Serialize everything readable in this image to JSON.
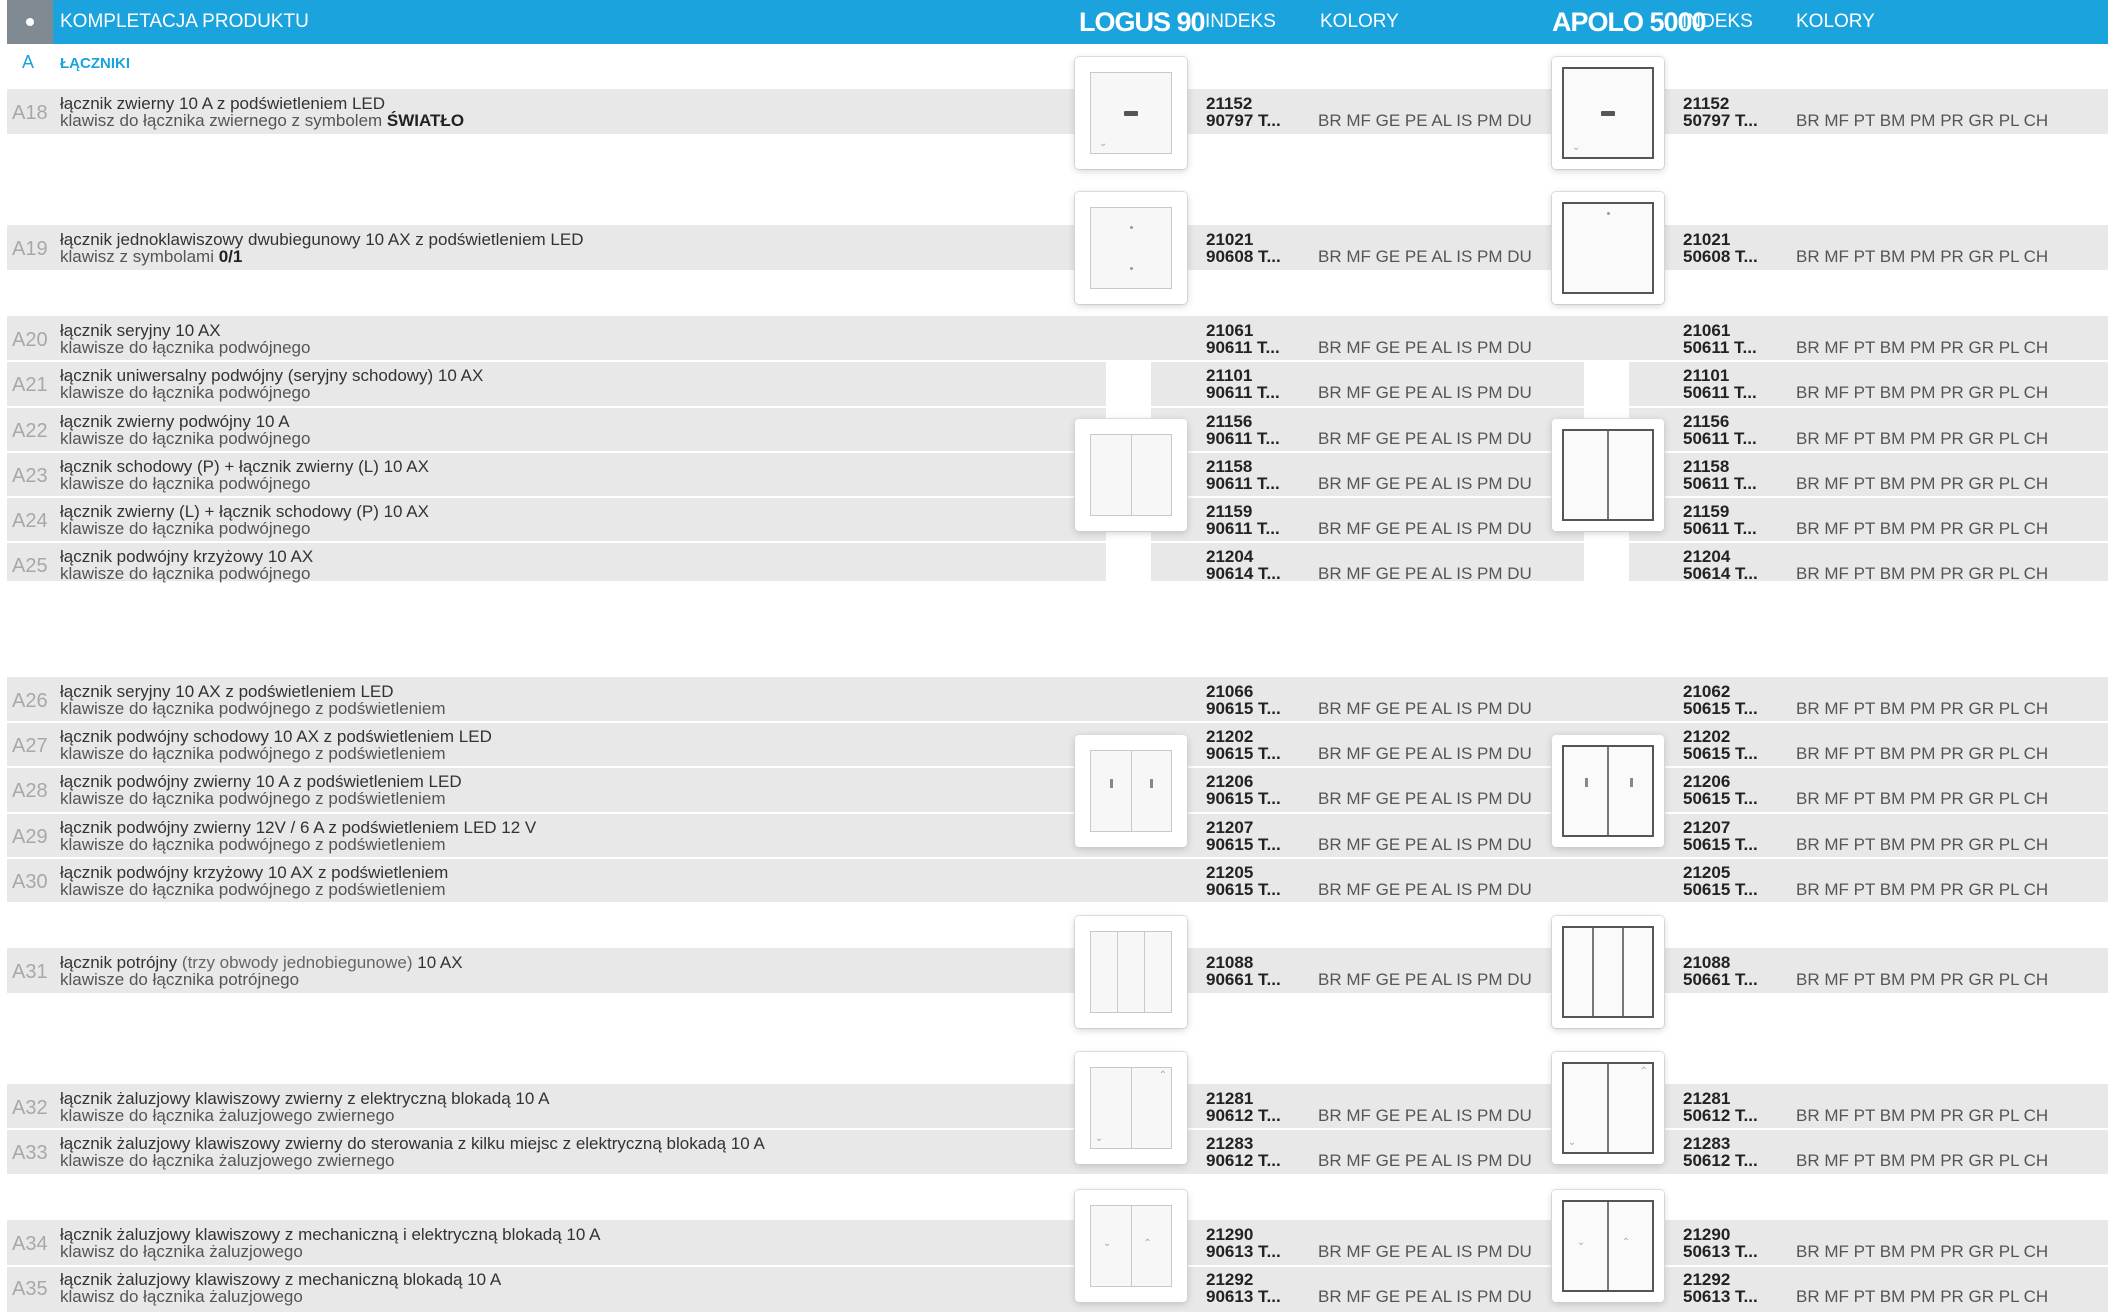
{
  "header": {
    "title": "KOMPLETACJA PRODUKTU",
    "brand1": "LOGUS 90",
    "indeks1": "INDEKS",
    "kolory1": "KOLORY",
    "brand2": "APOLO 5000",
    "indeks2": "INDEKS",
    "kolory2": "KOLORY"
  },
  "section": {
    "letter": "A",
    "title": "ŁĄCZNIKI"
  },
  "colors": {
    "logus": "BR MF GE PE AL IS PM DU",
    "apolo": "BR MF PT BM PM PR GR PL CH",
    "accent": "#1aa3dd"
  },
  "rows": [
    {
      "code": "A18",
      "line1": "łącznik zwierny 10 A z podświetleniem LED",
      "line2": "klawisz do łącznika zwiernego z symbolem",
      "line2_bold": "ŚWIATŁO",
      "l_idx1": "21152",
      "l_idx2": "90797 T...",
      "a_idx1": "21152",
      "a_idx2": "50797 T..."
    },
    {
      "code": "A19",
      "line1": "łącznik jednoklawiszowy dwubiegunowy 10 AX z podświetleniem LED",
      "line2": "klawisz z symbolami",
      "line2_bold": "0/1",
      "l_idx1": "21021",
      "l_idx2": "90608 T...",
      "a_idx1": "21021",
      "a_idx2": "50608 T..."
    },
    {
      "code": "A20",
      "line1": "łącznik seryjny 10 AX",
      "line2": "klawisze do łącznika podwójnego",
      "l_idx1": "21061",
      "l_idx2": "90611 T...",
      "a_idx1": "21061",
      "a_idx2": "50611 T..."
    },
    {
      "code": "A21",
      "line1": "łącznik uniwersalny podwójny (seryjny schodowy) 10 AX",
      "line2": "klawisze do łącznika podwójnego",
      "l_idx1": "21101",
      "l_idx2": "90611 T...",
      "a_idx1": "21101",
      "a_idx2": "50611 T..."
    },
    {
      "code": "A22",
      "line1": "łącznik zwierny podwójny 10 A",
      "line2": "klawisze do łącznika podwójnego",
      "l_idx1": "21156",
      "l_idx2": "90611 T...",
      "a_idx1": "21156",
      "a_idx2": "50611 T..."
    },
    {
      "code": "A23",
      "line1": "łącznik schodowy (P) + łącznik zwierny (L)  10 AX",
      "line2": "klawisze do łącznika podwójnego",
      "l_idx1": "21158",
      "l_idx2": "90611 T...",
      "a_idx1": "21158",
      "a_idx2": "50611 T..."
    },
    {
      "code": "A24",
      "line1": "łącznik zwierny (L) + łącznik schodowy (P) 10 AX",
      "line2": "klawisze do łącznika podwójnego",
      "l_idx1": "21159",
      "l_idx2": "90611 T...",
      "a_idx1": "21159",
      "a_idx2": "50611 T..."
    },
    {
      "code": "A25",
      "line1": "łącznik podwójny krzyżowy 10 AX",
      "line2": "klawisze do łącznika podwójnego",
      "l_idx1": "21204",
      "l_idx2": "90614 T...",
      "a_idx1": "21204",
      "a_idx2": "50614 T..."
    },
    {
      "code": "A26",
      "line1": "łącznik seryjny 10 AX z podświetleniem LED",
      "line2": "klawisze do łącznika podwójnego z podświetleniem",
      "l_idx1": "21066",
      "l_idx2": "90615 T...",
      "a_idx1": "21062",
      "a_idx2": "50615 T..."
    },
    {
      "code": "A27",
      "line1": "łącznik podwójny schodowy 10 AX z podświetleniem LED",
      "line2": "klawisze do łącznika podwójnego z podświetleniem",
      "l_idx1": "21202",
      "l_idx2": "90615 T...",
      "a_idx1": "21202",
      "a_idx2": "50615 T..."
    },
    {
      "code": "A28",
      "line1": "łącznik podwójny zwierny 10 A z podświetleniem LED",
      "line2": "klawisze do łącznika podwójnego z podświetleniem",
      "l_idx1": "21206",
      "l_idx2": "90615 T...",
      "a_idx1": "21206",
      "a_idx2": "50615 T..."
    },
    {
      "code": "A29",
      "line1": "łącznik podwójny zwierny 12V / 6 A z podświetleniem LED 12 V",
      "line2": "klawisze do łącznika podwójnego z podświetleniem",
      "l_idx1": "21207",
      "l_idx2": "90615 T...",
      "a_idx1": "21207",
      "a_idx2": "50615 T..."
    },
    {
      "code": "A30",
      "line1": "łącznik podwójny krzyżowy 10 AX z podświetleniem",
      "line2": "klawisze do łącznika podwójnego z podświetleniem",
      "l_idx1": "21205",
      "l_idx2": "90615 T...",
      "a_idx1": "21205",
      "a_idx2": "50615 T..."
    },
    {
      "code": "A31",
      "line1": "łącznik potrójny",
      "line1_light": "(trzy obwody jednobiegunowe)",
      "line1_tail": "10 AX",
      "line2": "klawisze do łącznika potrójnego",
      "l_idx1": "21088",
      "l_idx2": "90661 T...",
      "a_idx1": "21088",
      "a_idx2": "50661 T..."
    },
    {
      "code": "A32",
      "line1": "łącznik żaluzjowy klawiszowy zwierny z elektryczną blokadą 10 A",
      "line2": "klawisze do łącznika żaluzjowego zwiernego",
      "l_idx1": "21281",
      "l_idx2": "90612 T...",
      "a_idx1": "21281",
      "a_idx2": "50612 T..."
    },
    {
      "code": "A33",
      "line1": "łącznik żaluzjowy klawiszowy zwierny do sterowania z kilku miejsc z elektryczną blokadą 10 A",
      "line2": "klawisze do łącznika żaluzjowego zwiernego",
      "l_idx1": "21283",
      "l_idx2": "90612 T...",
      "a_idx1": "21283",
      "a_idx2": "50612 T..."
    },
    {
      "code": "A34",
      "line1": "łącznik żaluzjowy klawiszowy z mechaniczną i elektryczną blokadą 10 A",
      "line2": "klawisz do łącznika żaluzjowego",
      "l_idx1": "21290",
      "l_idx2": "90613 T...",
      "a_idx1": "21290",
      "a_idx2": "50613 T..."
    },
    {
      "code": "A35",
      "line1": "łącznik żaluzjowy klawiszowy z mechaniczną blokadą 10 A",
      "line2": "klawisz do łącznika żaluzjowego",
      "l_idx1": "21292",
      "l_idx2": "90613 T...",
      "a_idx1": "21292",
      "a_idx2": "50613 T..."
    }
  ]
}
